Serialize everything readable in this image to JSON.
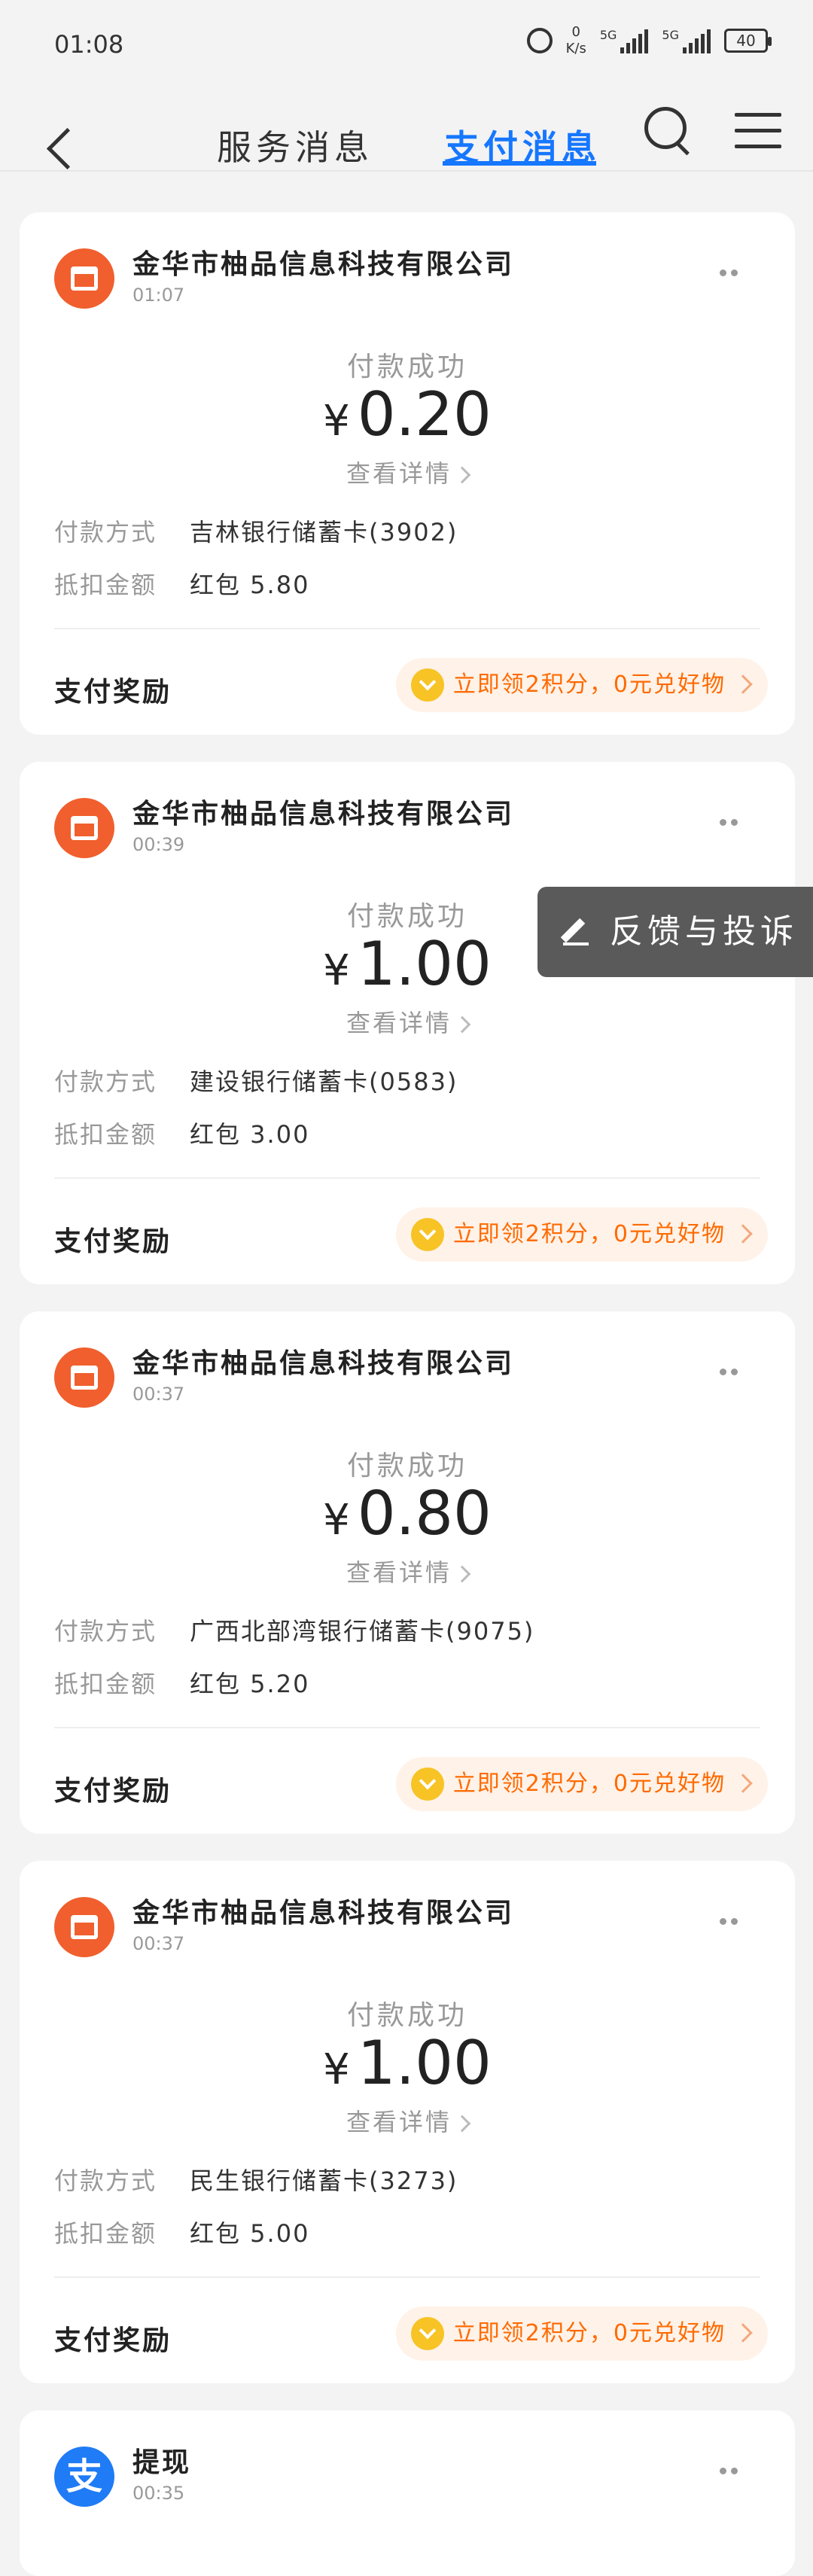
{
  "status_bar": {
    "time": "01:08",
    "net_speed_value": "0",
    "net_speed_unit": "K/s",
    "signal1": "5G",
    "signal2": "5G",
    "battery": "40"
  },
  "nav": {
    "tab_service": "服务消息",
    "tab_pay": "支付消息",
    "active_tab": "支付消息"
  },
  "feedback": {
    "label": "反馈与投诉"
  },
  "labels": {
    "status": "付款成功",
    "currency": "¥",
    "detail": "查看详情",
    "pay_method": "付款方式",
    "deduction": "抵扣金额",
    "reward": "支付奖励",
    "reward_button": "立即领2积分，0元兑好物"
  },
  "cards": [
    {
      "merchant": "金华市柚品信息科技有限公司",
      "time": "01:07",
      "amount": "0.20",
      "pay_method": "吉林银行储蓄卡(3902)",
      "deduction": "红包 5.80"
    },
    {
      "merchant": "金华市柚品信息科技有限公司",
      "time": "00:39",
      "amount": "1.00",
      "pay_method": "建设银行储蓄卡(0583)",
      "deduction": "红包 3.00"
    },
    {
      "merchant": "金华市柚品信息科技有限公司",
      "time": "00:37",
      "amount": "0.80",
      "pay_method": "广西北部湾银行储蓄卡(9075)",
      "deduction": "红包 5.20"
    },
    {
      "merchant": "金华市柚品信息科技有限公司",
      "time": "00:37",
      "amount": "1.00",
      "pay_method": "民生银行储蓄卡(3273)",
      "deduction": "红包 5.00"
    }
  ],
  "last_card": {
    "title": "提现",
    "time": "00:35",
    "logo_char": "支"
  }
}
